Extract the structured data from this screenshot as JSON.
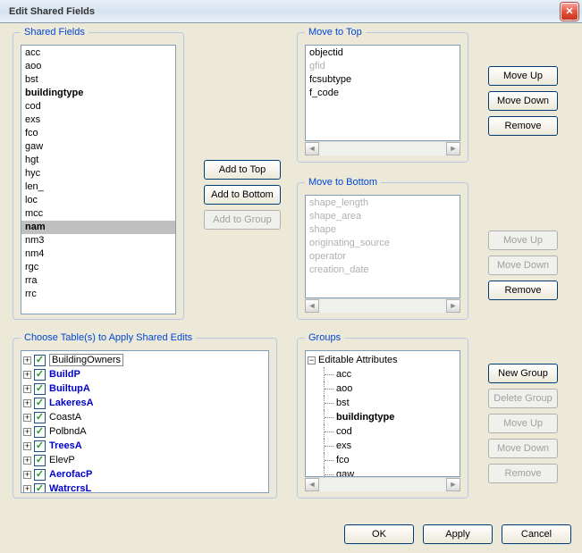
{
  "title": "Edit Shared Fields",
  "sharedFields": {
    "legend": "Shared Fields",
    "items": [
      {
        "label": "acc"
      },
      {
        "label": "aoo"
      },
      {
        "label": "bst"
      },
      {
        "label": "buildingtype",
        "bold": true
      },
      {
        "label": "cod"
      },
      {
        "label": "exs"
      },
      {
        "label": "fco"
      },
      {
        "label": "gaw"
      },
      {
        "label": "hgt"
      },
      {
        "label": "hyc"
      },
      {
        "label": "len_"
      },
      {
        "label": "loc"
      },
      {
        "label": "mcc"
      },
      {
        "label": "nam",
        "selected": true
      },
      {
        "label": "nm3"
      },
      {
        "label": "nm4"
      },
      {
        "label": "rgc"
      },
      {
        "label": "rra"
      },
      {
        "label": "rrc"
      }
    ]
  },
  "middleButtons": {
    "addTop": "Add to Top",
    "addBottom": "Add to Bottom",
    "addGroup": "Add to Group"
  },
  "moveTop": {
    "legend": "Move to Top",
    "items": [
      {
        "label": "objectid"
      },
      {
        "label": "gfid",
        "disabled": true
      },
      {
        "label": "fcsubtype"
      },
      {
        "label": "f_code"
      }
    ],
    "buttons": {
      "up": "Move Up",
      "down": "Move Down",
      "remove": "Remove"
    }
  },
  "moveBottom": {
    "legend": "Move to Bottom",
    "items": [
      {
        "label": "shape_length",
        "disabled": true
      },
      {
        "label": "shape_area",
        "disabled": true
      },
      {
        "label": "shape",
        "disabled": true
      },
      {
        "label": "originating_source",
        "disabled": true
      },
      {
        "label": "operator",
        "disabled": true
      },
      {
        "label": "creation_date",
        "disabled": true
      }
    ],
    "buttons": {
      "up": "Move Up",
      "down": "Move Down",
      "remove": "Remove"
    }
  },
  "tables": {
    "legend": "Choose Table(s) to Apply Shared Edits",
    "items": [
      {
        "label": "BuildingOwners",
        "checked": true,
        "editing": true
      },
      {
        "label": "BuildP",
        "checked": true,
        "boldBlue": true
      },
      {
        "label": "BuiltupA",
        "checked": true,
        "boldBlue": true
      },
      {
        "label": "LakeresA",
        "checked": true,
        "boldBlue": true
      },
      {
        "label": "CoastA",
        "checked": true
      },
      {
        "label": "PolbndA",
        "checked": true
      },
      {
        "label": "TreesA",
        "checked": true,
        "boldBlue": true
      },
      {
        "label": "ElevP",
        "checked": true
      },
      {
        "label": "AerofacP",
        "checked": true,
        "boldBlue": true
      },
      {
        "label": "WatrcrsL",
        "checked": true,
        "boldBlue": true
      }
    ]
  },
  "groups": {
    "legend": "Groups",
    "root": "Editable Attributes",
    "items": [
      {
        "label": "acc"
      },
      {
        "label": "aoo"
      },
      {
        "label": "bst"
      },
      {
        "label": "buildingtype",
        "bold": true
      },
      {
        "label": "cod"
      },
      {
        "label": "exs"
      },
      {
        "label": "fco"
      },
      {
        "label": "gaw"
      }
    ],
    "buttons": {
      "new": "New Group",
      "delete": "Delete Group",
      "up": "Move Up",
      "down": "Move Down",
      "remove": "Remove"
    }
  },
  "footer": {
    "ok": "OK",
    "apply": "Apply",
    "cancel": "Cancel"
  }
}
